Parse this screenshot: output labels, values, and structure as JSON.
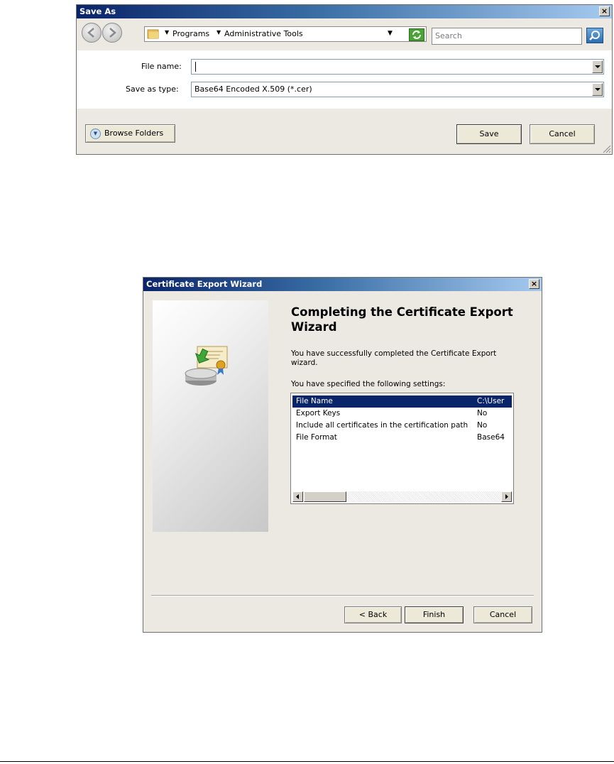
{
  "save_as": {
    "title": "Save As",
    "close_glyph": "×",
    "breadcrumb": [
      "Programs",
      "Administrative Tools"
    ],
    "search_placeholder": "Search",
    "file_name_label": "File name:",
    "file_name_value": "",
    "save_type_label": "Save as type:",
    "save_type_value": "Base64 Encoded X.509 (*.cer)",
    "browse_folders_label": "Browse Folders",
    "save_label": "Save",
    "cancel_label": "Cancel"
  },
  "wizard": {
    "title": "Certificate Export Wizard",
    "close_glyph": "×",
    "heading": "Completing the Certificate Export Wizard",
    "success_text": "You have successfully completed the Certificate Export wizard.",
    "settings_intro": "You have specified the following settings:",
    "settings": [
      {
        "name": "File Name",
        "value": "C:\\User"
      },
      {
        "name": "Export Keys",
        "value": "No"
      },
      {
        "name": "Include all certificates in the certification path",
        "value": "No"
      },
      {
        "name": "File Format",
        "value": "Base64"
      }
    ],
    "back_label": "< Back",
    "finish_label": "Finish",
    "cancel_label": "Cancel"
  },
  "icons": {
    "nav": [
      "back-arrow-icon",
      "forward-arrow-icon"
    ],
    "folder": "folder-icon",
    "refresh": "refresh-icon",
    "search": "search-icon",
    "chevron": "chevron-down-icon",
    "wizard_art": "certificate-disk-icon"
  },
  "colors": {
    "titlebar_start": "#0a246a",
    "titlebar_end": "#a6caf0",
    "dialog_bg": "#ebe9e2",
    "selection": "#0a246a"
  }
}
